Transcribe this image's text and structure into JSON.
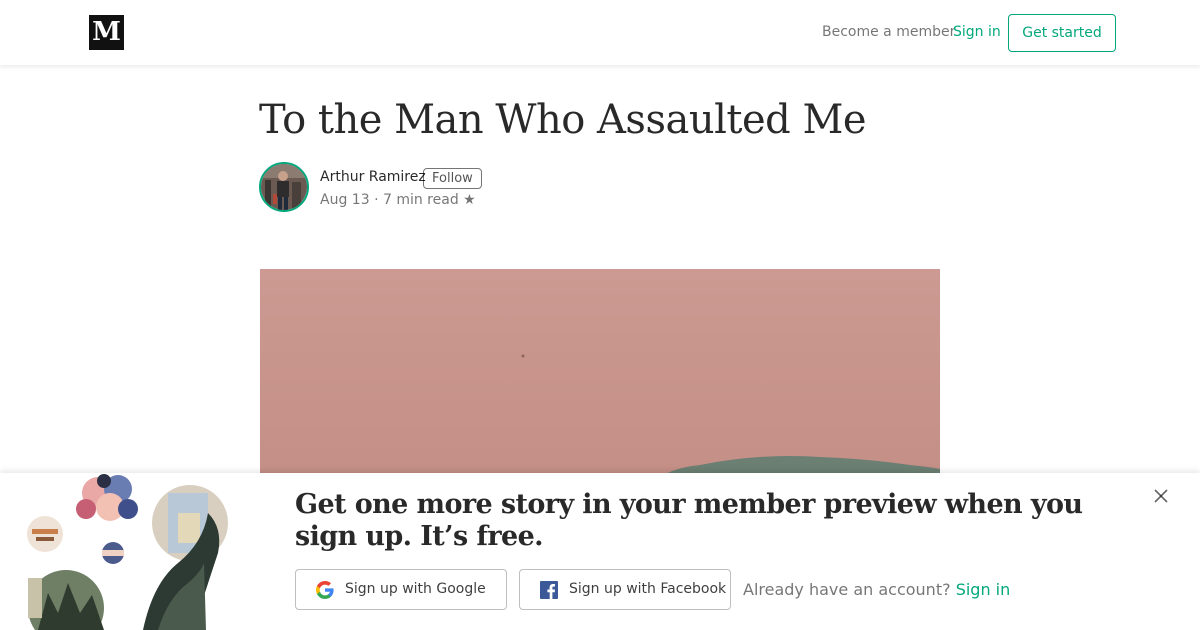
{
  "header": {
    "logo_letter": "M",
    "become_member": "Become a member",
    "sign_in": "Sign in",
    "get_started": "Get started"
  },
  "article": {
    "title": "To the Man Who Assaulted Me",
    "author": {
      "name": "Arthur Ramirez",
      "follow_label": "Follow"
    },
    "date": "Aug 13",
    "separator": "·",
    "read_time": "7 min read",
    "star": "★"
  },
  "banner": {
    "headline": "Get one more story in your member preview when you sign up. It’s free.",
    "google_label": "Sign up with Google",
    "facebook_label": "Sign up with Facebook",
    "already_text": "Already have an account?",
    "sign_in": "Sign in"
  },
  "colors": {
    "accent": "#03a87c",
    "hero_wall": "#cc9a92",
    "facebook": "#3b5998"
  },
  "icons": [
    "medium-logo-icon",
    "google-icon",
    "facebook-icon",
    "close-icon",
    "star-icon"
  ]
}
